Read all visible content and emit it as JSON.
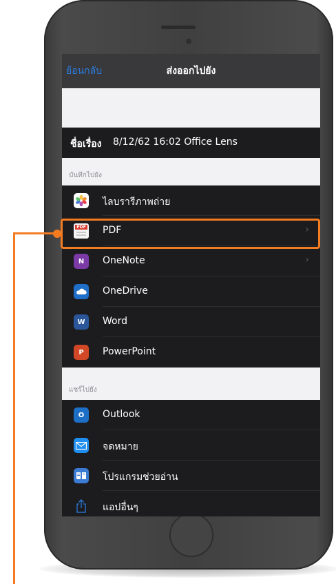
{
  "nav": {
    "back_label": "ย้อนกลับ",
    "title": "ส่งออกไปยัง"
  },
  "document": {
    "title_label": "ชื่อเรื่อง",
    "title_value": "8/12/62 16:02 Office Lens"
  },
  "save_section": {
    "header": "บันทึกไปยัง",
    "items": [
      {
        "label": "ไลบรารีภาพถ่าย",
        "icon": "photos-icon",
        "has_chevron": false
      },
      {
        "label": "PDF",
        "icon": "pdf-icon",
        "has_chevron": true
      },
      {
        "label": "OneNote",
        "icon": "onenote-icon",
        "has_chevron": true
      },
      {
        "label": "OneDrive",
        "icon": "onedrive-icon",
        "has_chevron": false
      },
      {
        "label": "Word",
        "icon": "word-icon",
        "has_chevron": false
      },
      {
        "label": "PowerPoint",
        "icon": "powerpoint-icon",
        "has_chevron": false
      }
    ]
  },
  "share_section": {
    "header": "แชร์ไปยัง",
    "items": [
      {
        "label": "Outlook",
        "icon": "outlook-icon"
      },
      {
        "label": "จดหมาย",
        "icon": "mail-icon"
      },
      {
        "label": "โปรแกรมช่วยอ่าน",
        "icon": "immersive-reader-icon"
      },
      {
        "label": "แอปอื่นๆ",
        "icon": "share-icon"
      }
    ]
  },
  "icons": {
    "chevron": "›",
    "pdf": "PDF",
    "onenote": "N",
    "word": "W",
    "powerpoint": "P",
    "outlook": "O"
  },
  "colors": {
    "accent": "#2a7de1",
    "callout": "#f47b20",
    "onenote": "#7b3aa6",
    "onedrive": "#1f6ec8",
    "word": "#2b579a",
    "powerpoint": "#d24726",
    "outlook": "#1d6fc6"
  }
}
